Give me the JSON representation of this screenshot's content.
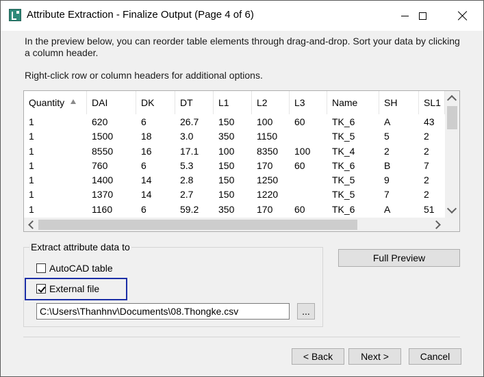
{
  "window": {
    "title": "Attribute Extraction - Finalize Output (Page 4 of 6)",
    "icon": "autocad-app-icon",
    "controls": [
      "minimize-icon",
      "maximize-icon",
      "close-icon"
    ]
  },
  "instructions": {
    "line1": "In the preview below, you can reorder table elements through drag-and-drop. Sort your data by clicking a column header.",
    "line2": "Right-click row or column headers for additional options."
  },
  "grid": {
    "columns": [
      {
        "label": "Quantity",
        "width": 92
      },
      {
        "label": "DAI",
        "width": 72
      },
      {
        "label": "DK",
        "width": 57
      },
      {
        "label": "DT",
        "width": 56
      },
      {
        "label": "L1",
        "width": 56
      },
      {
        "label": "L2",
        "width": 55
      },
      {
        "label": "L3",
        "width": 55
      },
      {
        "label": "Name",
        "width": 76
      },
      {
        "label": "SH",
        "width": 58
      },
      {
        "label": "SL1",
        "width": 38
      }
    ],
    "sort_column": "Quantity",
    "sort_direction": "ascending",
    "rows": [
      [
        "1",
        "620",
        "6",
        "26.7",
        "150",
        "100",
        "60",
        "TK_6",
        "A",
        "43"
      ],
      [
        "1",
        "1500",
        "18",
        "3.0",
        "350",
        "1150",
        "",
        "TK_5",
        "5",
        "2"
      ],
      [
        "1",
        "8550",
        "16",
        "17.1",
        "100",
        "8350",
        "100",
        "TK_4",
        "2",
        "2"
      ],
      [
        "1",
        "760",
        "6",
        "5.3",
        "150",
        "170",
        "60",
        "TK_6",
        "B",
        "7"
      ],
      [
        "1",
        "1400",
        "14",
        "2.8",
        "150",
        "1250",
        "",
        "TK_5",
        "9",
        "2"
      ],
      [
        "1",
        "1370",
        "14",
        "2.7",
        "150",
        "1220",
        "",
        "TK_5",
        "7",
        "2"
      ],
      [
        "1",
        "1160",
        "6",
        "59.2",
        "350",
        "170",
        "60",
        "TK_6",
        "A",
        "51"
      ]
    ]
  },
  "extract": {
    "group_title": "Extract attribute data to",
    "autocad_table": {
      "label": "AutoCAD table",
      "checked": false
    },
    "external_file": {
      "label": "External file",
      "checked": true
    },
    "file_path": "C:\\Users\\Thanhnv\\Documents\\08.Thongke.csv",
    "browse_label": "..."
  },
  "buttons": {
    "full_preview": "Full Preview",
    "back": "< Back",
    "next": "Next >",
    "cancel": "Cancel"
  },
  "colors": {
    "highlight_border": "#1b2ea6",
    "dialog_bg": "#f0f0f0",
    "button_bg": "#e1e1e1"
  }
}
